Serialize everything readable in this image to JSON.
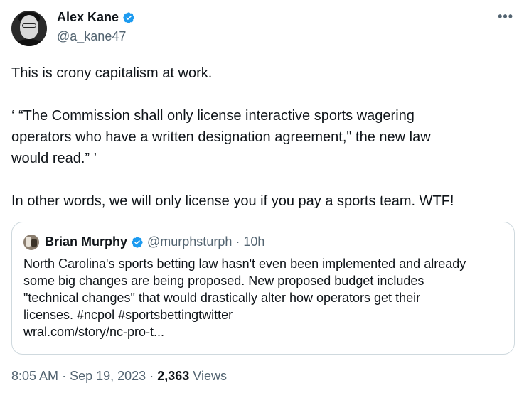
{
  "author": {
    "name": "Alex Kane",
    "handle": "@a_kane47"
  },
  "icons": {
    "verified": "verified-badge-icon",
    "more": "more-options-icon"
  },
  "colors": {
    "verified": "#1d9bf0",
    "text": "#0f1419",
    "secondary": "#536471",
    "border": "#cfd9de"
  },
  "tweet": {
    "line1": "This is crony capitalism at work.",
    "quote_lines": [
      "‘ “The Commission shall only license interactive sports wagering",
      "operators who have a written designation agreement,\" the new law",
      "would read.” ’"
    ],
    "line3": "In other words, we will only license you if you pay a sports team. WTF!"
  },
  "quoted_tweet": {
    "name": "Brian Murphy",
    "handle": "@murphsturph",
    "separator": "·",
    "time": "10h",
    "lines": [
      "North Carolina's sports betting law hasn't even been implemented and already",
      "some big changes are being proposed. New proposed budget includes",
      "\"technical changes\" that would drastically alter how operators get their",
      "licenses. #ncpol #sportsbettingtwitter",
      "wral.com/story/nc-pro-t..."
    ]
  },
  "meta": {
    "time": "8:05 AM",
    "separator": "·",
    "date": "Sep 19, 2023",
    "views_count": "2,363",
    "views_label": "Views"
  }
}
